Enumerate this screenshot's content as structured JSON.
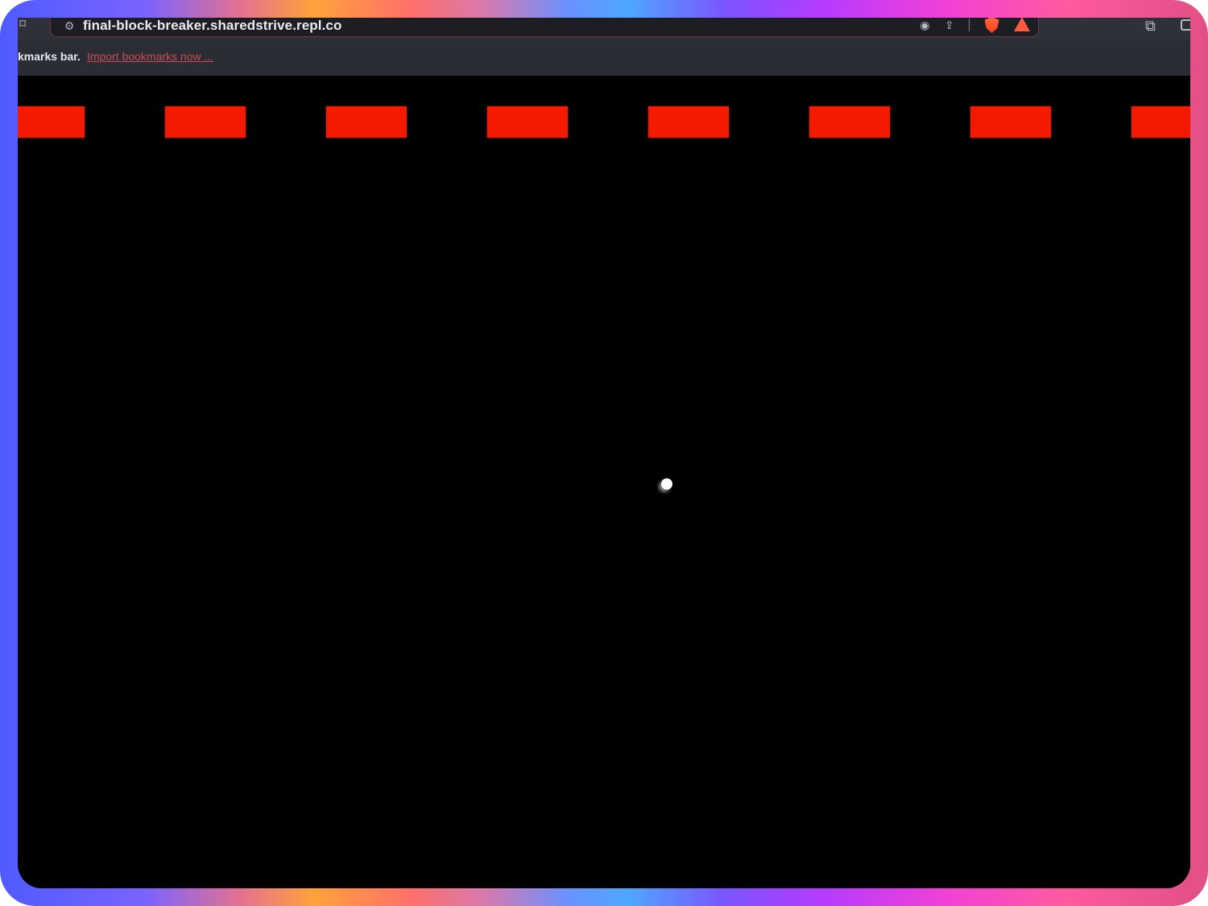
{
  "browser": {
    "url": "final-block-breaker.sharedstrive.repl.co",
    "bookmarks_bar": {
      "text": "kmarks bar.",
      "link": "Import bookmarks now ..."
    },
    "icons": {
      "bookmark": "bookmark-icon",
      "site_settings": "site-settings-icon",
      "media": "media-icon",
      "share": "share-icon",
      "brave": "brave-shields-icon",
      "rewards": "brave-rewards-icon",
      "extensions": "extensions-icon",
      "sidepanel": "sidepanel-icon"
    },
    "accent_color": "#c94a55"
  },
  "game": {
    "background": "#000000",
    "brick_color": "#f41a00",
    "ball_color": "#ffffff",
    "bricks_visible": 8
  }
}
